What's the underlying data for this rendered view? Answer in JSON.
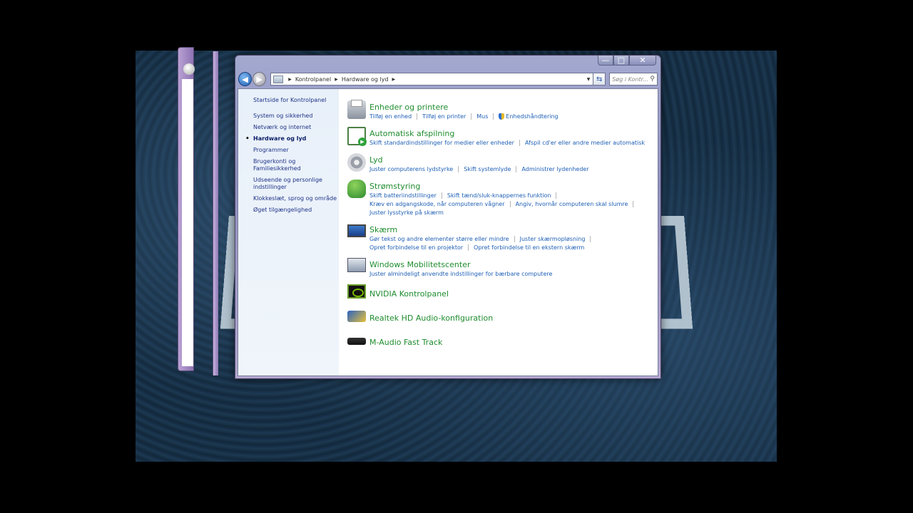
{
  "window": {
    "controls": {
      "minimize": "—",
      "maximize": "□",
      "close": "✕"
    },
    "breadcrumb": [
      "Kontrolpanel",
      "Hardware og lyd"
    ],
    "search_placeholder": "Søg i Kontr..."
  },
  "leftpane": {
    "home": "Startside for Kontrolpanel",
    "items": [
      "System og sikkerhed",
      "Netværk og internet",
      "Hardware og lyd",
      "Programmer",
      "Brugerkonti og Familiesikkerhed",
      "Udseende og personlige indstillinger",
      "Klokkeslæt, sprog og område",
      "Øget tilgængelighed"
    ],
    "active_index": 2
  },
  "categories": [
    {
      "title": "Enheder og printere",
      "icon": "printer-icon",
      "lines": [
        [
          "Tilføj en enhed",
          "Tilføj en printer",
          "Mus",
          "Enhedshåndtering"
        ]
      ]
    },
    {
      "title": "Automatisk afspilning",
      "icon": "autoplay-icon",
      "lines": [
        [
          "Skift standardindstillinger for medier eller enheder",
          "Afspil cd'er eller andre medier automatisk"
        ]
      ]
    },
    {
      "title": "Lyd",
      "icon": "speaker-icon",
      "lines": [
        [
          "Juster computerens lydstyrke",
          "Skift systemlyde",
          "Administrer lydenheder"
        ]
      ]
    },
    {
      "title": "Strømstyring",
      "icon": "power-icon",
      "lines": [
        [
          "Skift batteriindstillinger",
          "Skift tænd/sluk-knappernes funktion"
        ],
        [
          "Kræv en adgangskode, når computeren vågner",
          "Angiv, hvornår computeren skal slumre"
        ],
        [
          "Juster lysstyrke på skærm"
        ]
      ]
    },
    {
      "title": "Skærm",
      "icon": "display-icon",
      "lines": [
        [
          "Gør tekst og andre elementer større eller mindre",
          "Juster skærmopløsning"
        ],
        [
          "Opret forbindelse til en projektor",
          "Opret forbindelse til en ekstern skærm"
        ]
      ]
    },
    {
      "title": "Windows Mobilitetscenter",
      "icon": "mobility-icon",
      "lines": [
        [
          "Juster almindeligt anvendte indstillinger for bærbare computere"
        ]
      ]
    }
  ],
  "extra_items": [
    {
      "title": "NVIDIA Kontrolpanel",
      "icon": "nvidia-icon"
    },
    {
      "title": "Realtek HD Audio-konfiguration",
      "icon": "realtek-icon"
    },
    {
      "title": "M-Audio Fast Track",
      "icon": "maudio-icon"
    }
  ]
}
